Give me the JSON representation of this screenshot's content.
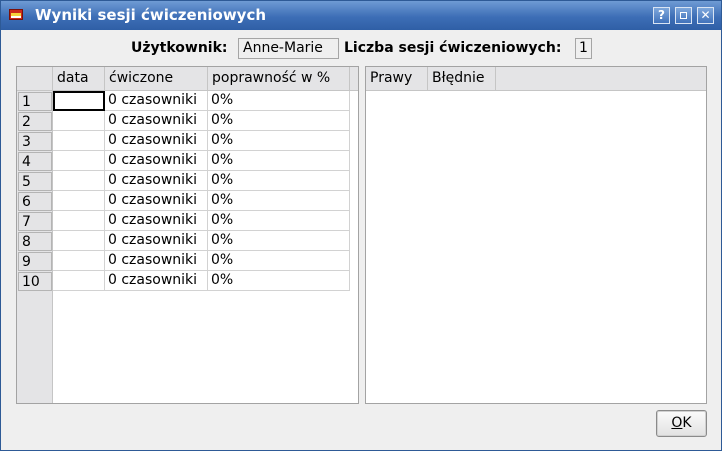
{
  "window": {
    "title": "Wyniki sesji ćwiczeniowych",
    "help_button": "?",
    "close_button": "✕"
  },
  "info": {
    "user_label": "Użytkownik:",
    "user_value": "Anne-Marie",
    "sessions_label": "Liczba sesji ćwiczeniowych:",
    "sessions_value": "1"
  },
  "results_table": {
    "columns": [
      "data",
      "ćwiczone",
      "poprawność w %"
    ],
    "rows": [
      {
        "num": "1",
        "date": "",
        "exercised": "0 czasowniki",
        "correct": "0%"
      },
      {
        "num": "2",
        "date": "",
        "exercised": "0 czasowniki",
        "correct": "0%"
      },
      {
        "num": "3",
        "date": "",
        "exercised": "0 czasowniki",
        "correct": "0%"
      },
      {
        "num": "4",
        "date": "",
        "exercised": "0 czasowniki",
        "correct": "0%"
      },
      {
        "num": "5",
        "date": "",
        "exercised": "0 czasowniki",
        "correct": "0%"
      },
      {
        "num": "6",
        "date": "",
        "exercised": "0 czasowniki",
        "correct": "0%"
      },
      {
        "num": "7",
        "date": "",
        "exercised": "0 czasowniki",
        "correct": "0%"
      },
      {
        "num": "8",
        "date": "",
        "exercised": "0 czasowniki",
        "correct": "0%"
      },
      {
        "num": "9",
        "date": "",
        "exercised": "0 czasowniki",
        "correct": "0%"
      },
      {
        "num": "10",
        "date": "",
        "exercised": "0 czasowniki",
        "correct": "0%"
      }
    ]
  },
  "detail_table": {
    "columns": [
      "Prawy",
      "Błędnie"
    ]
  },
  "buttons": {
    "ok_mnemonic": "O",
    "ok_rest": "K"
  },
  "colors": {
    "titlebar": "#3d6eb6",
    "background": "#efefef"
  }
}
